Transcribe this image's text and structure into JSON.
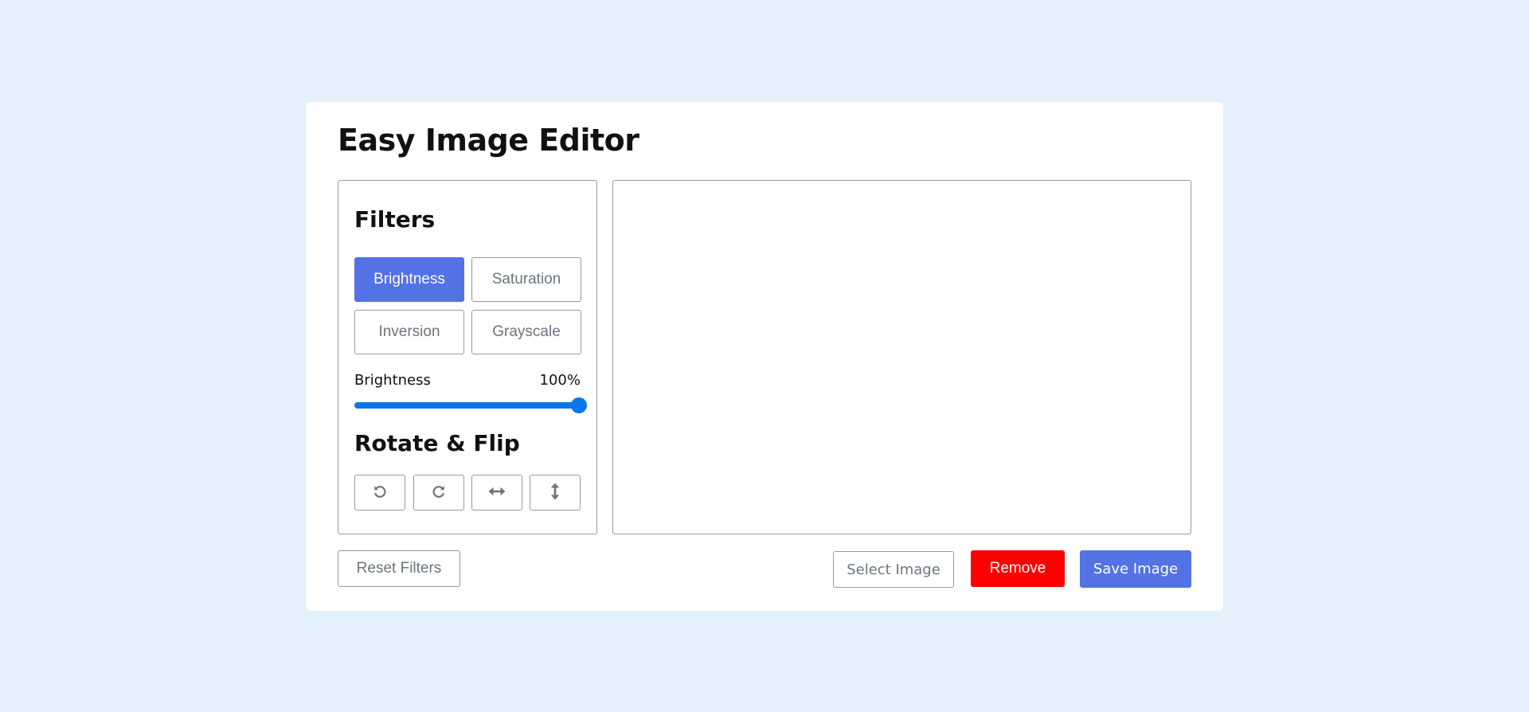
{
  "app": {
    "title": "Easy Image Editor"
  },
  "filters": {
    "title": "Filters",
    "options": [
      "Brightness",
      "Saturation",
      "Inversion",
      "Grayscale"
    ],
    "active": "Brightness"
  },
  "slider": {
    "label": "Brightness",
    "value_text": "100%",
    "value": 100,
    "max": 200,
    "fill_fraction": 1.0
  },
  "rotate": {
    "title": "Rotate & Flip",
    "buttons": [
      {
        "icon": "rotate-left-icon"
      },
      {
        "icon": "rotate-right-icon"
      },
      {
        "icon": "flip-horizontal-icon"
      },
      {
        "icon": "flip-vertical-icon"
      }
    ]
  },
  "actions": {
    "reset": "Reset Filters",
    "select": "Select Image",
    "remove": "Remove",
    "save": "Save Image"
  },
  "colors": {
    "background": "#e3f0fc",
    "primary": "#5372e4",
    "danger": "#ff0000",
    "slider": "#0b74e8",
    "muted_text": "#6c757d"
  }
}
